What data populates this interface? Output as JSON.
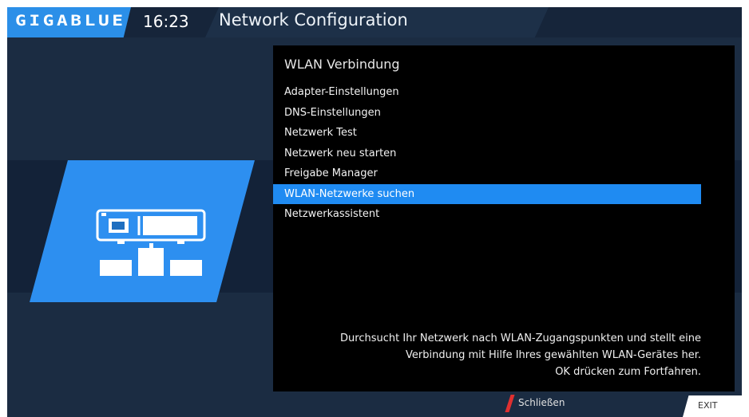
{
  "header": {
    "logo": "GIGABLUE",
    "time": "16:23",
    "title": "Network Configuration"
  },
  "panel": {
    "title": "WLAN Verbindung",
    "menu": [
      {
        "label": "Adapter-Einstellungen",
        "selected": false
      },
      {
        "label": "DNS-Einstellungen",
        "selected": false
      },
      {
        "label": "Netzwerk Test",
        "selected": false
      },
      {
        "label": "Netzwerk neu starten",
        "selected": false
      },
      {
        "label": "Freigabe Manager",
        "selected": false
      },
      {
        "label": "WLAN-Netzwerke suchen",
        "selected": true
      },
      {
        "label": "Netzwerkassistent",
        "selected": false
      }
    ],
    "description": [
      "Durchsucht Ihr Netzwerk nach WLAN-Zugangspunkten und stellt eine",
      "Verbindung mit Hilfe Ihres gewählten WLAN-Gerätes her.",
      "OK drücken zum Fortfahren."
    ]
  },
  "footer": {
    "red_button_label": "Schließen",
    "exit_key_label": "EXIT"
  },
  "colors": {
    "background": "#1b2c42",
    "accent": "#1f8bf2",
    "panel": "#000000",
    "red_key": "#e03030"
  },
  "icons": [
    "network-device-icon"
  ]
}
